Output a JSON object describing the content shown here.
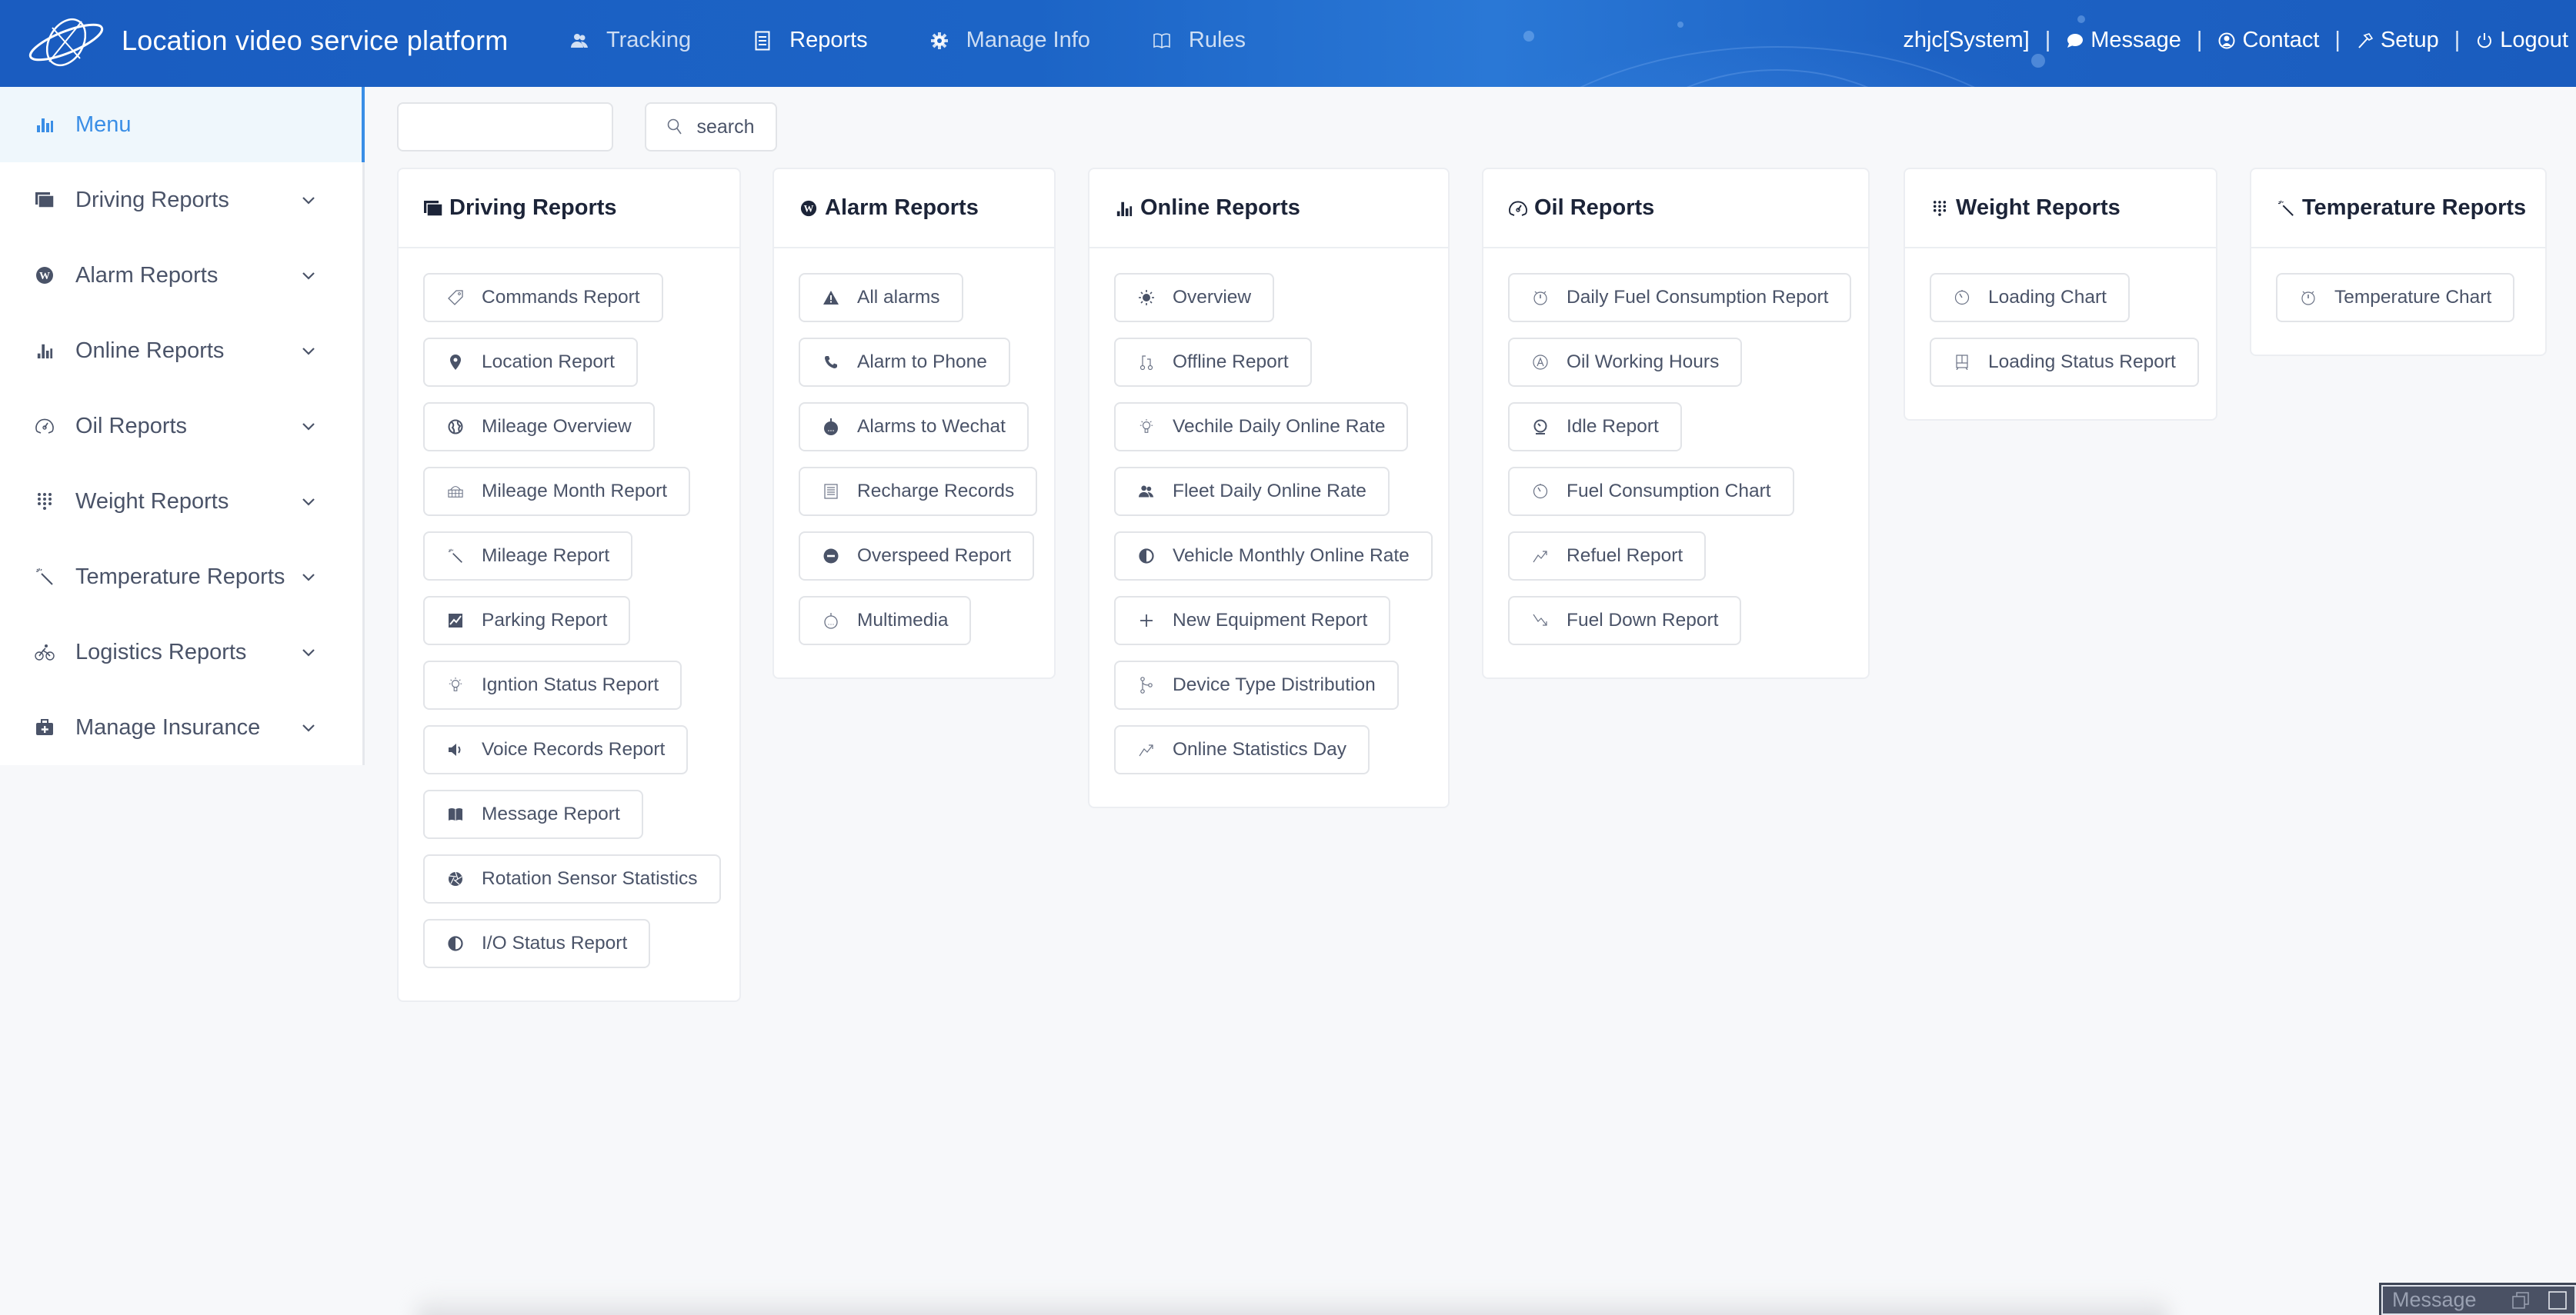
{
  "header": {
    "app_title": "Location video service platform",
    "nav": [
      {
        "label": "Tracking",
        "icon": "users-icon",
        "active": false
      },
      {
        "label": "Reports",
        "icon": "document-icon",
        "active": true
      },
      {
        "label": "Manage Info",
        "icon": "gear-icon",
        "active": false
      },
      {
        "label": "Rules",
        "icon": "book-icon",
        "active": false
      }
    ],
    "user": "zhjc[System]",
    "user_links": [
      {
        "label": "Message",
        "icon": "chat-bubble-icon"
      },
      {
        "label": "Contact",
        "icon": "user-circle-icon"
      },
      {
        "label": "Setup",
        "icon": "hammer-icon"
      },
      {
        "label": "Logout",
        "icon": "power-icon"
      }
    ],
    "separator": "|"
  },
  "sidebar": {
    "menu_label": "Menu",
    "items": [
      {
        "label": "Driving Reports",
        "icon": "stacked-squares-icon"
      },
      {
        "label": "Alarm Reports",
        "icon": "wordpress-icon"
      },
      {
        "label": "Online Reports",
        "icon": "bar-chart-icon"
      },
      {
        "label": "Oil Reports",
        "icon": "speedometer-icon"
      },
      {
        "label": "Weight Reports",
        "icon": "dialpad-icon"
      },
      {
        "label": "Temperature Reports",
        "icon": "magic-wand-icon"
      },
      {
        "label": "Logistics Reports",
        "icon": "bicycle-icon"
      },
      {
        "label": "Manage Insurance",
        "icon": "medkit-icon"
      }
    ]
  },
  "search": {
    "value": "",
    "placeholder": "",
    "button_label": "search"
  },
  "cards": [
    {
      "title": "Driving Reports",
      "icon": "stacked-squares-icon",
      "items": [
        {
          "label": "Commands Report",
          "icon": "tag-icon"
        },
        {
          "label": "Location Report",
          "icon": "map-pin-icon"
        },
        {
          "label": "Mileage Overview",
          "icon": "globe-icon"
        },
        {
          "label": "Mileage Month Report",
          "icon": "basket-icon"
        },
        {
          "label": "Mileage Report",
          "icon": "magic-wand-icon"
        },
        {
          "label": "Parking Report",
          "icon": "chart-box-icon"
        },
        {
          "label": "Igntion Status Report",
          "icon": "lightbulb-icon"
        },
        {
          "label": "Voice Records Report",
          "icon": "speaker-icon"
        },
        {
          "label": "Message Report",
          "icon": "open-book-icon"
        },
        {
          "label": "Rotation Sensor Statistics",
          "icon": "aperture-icon"
        },
        {
          "label": "I/O Status Report",
          "icon": "contrast-icon"
        }
      ]
    },
    {
      "title": "Alarm Reports",
      "icon": "wordpress-icon",
      "items": [
        {
          "label": "All alarms",
          "icon": "warning-icon"
        },
        {
          "label": "Alarm to Phone",
          "icon": "phone-icon"
        },
        {
          "label": "Alarms to Wechat",
          "icon": "bot-icon"
        },
        {
          "label": "Recharge Records",
          "icon": "list-icon"
        },
        {
          "label": "Overspeed Report",
          "icon": "minus-circle-icon"
        },
        {
          "label": "Multimedia",
          "icon": "bot-outline-icon"
        }
      ]
    },
    {
      "title": "Online Reports",
      "icon": "bar-chart-icon",
      "items": [
        {
          "label": "Overview",
          "icon": "sun-icon"
        },
        {
          "label": "Offline Report",
          "icon": "git-compare-icon"
        },
        {
          "label": "Vechile Daily Online Rate",
          "icon": "lightbulb-icon"
        },
        {
          "label": "Fleet Daily Online Rate",
          "icon": "users-icon"
        },
        {
          "label": "Vehicle Monthly Online Rate",
          "icon": "contrast-icon"
        },
        {
          "label": "New Equipment Report",
          "icon": "plus-icon"
        },
        {
          "label": "Device Type Distribution",
          "icon": "git-branch-icon"
        },
        {
          "label": "Online Statistics Day",
          "icon": "trending-up-icon"
        }
      ]
    },
    {
      "title": "Oil Reports",
      "icon": "speedometer-icon",
      "items": [
        {
          "label": "Daily Fuel Consumption Report",
          "icon": "stopwatch-icon"
        },
        {
          "label": "Oil Working Hours",
          "icon": "app-store-icon"
        },
        {
          "label": "Idle Report",
          "icon": "gauge-icon"
        },
        {
          "label": "Fuel Consumption Chart",
          "icon": "timer-icon"
        },
        {
          "label": "Refuel Report",
          "icon": "trending-up-icon"
        },
        {
          "label": "Fuel Down Report",
          "icon": "trending-down-icon"
        }
      ]
    },
    {
      "title": "Weight Reports",
      "icon": "dialpad-icon",
      "items": [
        {
          "label": "Loading Chart",
          "icon": "timer-icon"
        },
        {
          "label": "Loading Status Report",
          "icon": "train-icon"
        }
      ]
    },
    {
      "title": "Temperature Reports",
      "icon": "magic-wand-icon",
      "items": [
        {
          "label": "Temperature Chart",
          "icon": "stopwatch-icon"
        }
      ]
    }
  ],
  "message_dock": {
    "label": "Message"
  }
}
